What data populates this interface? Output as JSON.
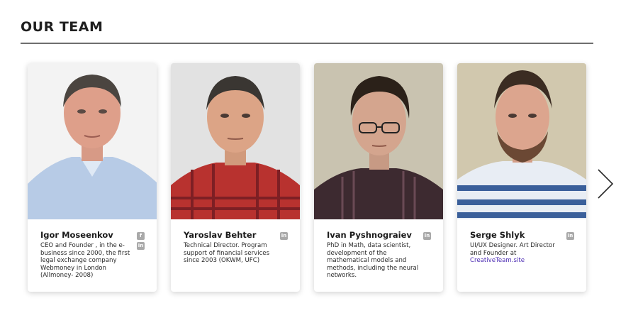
{
  "section": {
    "title": "OUR TEAM"
  },
  "members": [
    {
      "name": "Igor Moseenkov",
      "description": "CEO and Founder , in the e-business since 2000, the first legal exchange company Webmoney in London (Allmoney- 2008)",
      "social": [
        "facebook-icon",
        "linkedin-icon"
      ]
    },
    {
      "name": "Yaroslav Behter",
      "description": "Technical Director. Program support of financial services since 2003 (OKWM, UFC)",
      "social": [
        "linkedin-icon"
      ]
    },
    {
      "name": "Ivan Pyshnograiev",
      "description": "PhD in Math, data scientist, development of the mathematical models and methods, including the neural networks.",
      "social": [
        "linkedin-icon"
      ]
    },
    {
      "name": "Serge Shlyk",
      "description": "UI/UX Designer. Art Director and Founder at",
      "link": "CreativeTeam.site",
      "social": [
        "linkedin-icon"
      ]
    }
  ],
  "icons": {
    "facebook": "f",
    "linkedin": "in",
    "next": "chevron-right-icon"
  },
  "colors": {
    "link": "#4b2bb3",
    "icon": "#a9a9a9",
    "rule": "#6e6e6e"
  }
}
